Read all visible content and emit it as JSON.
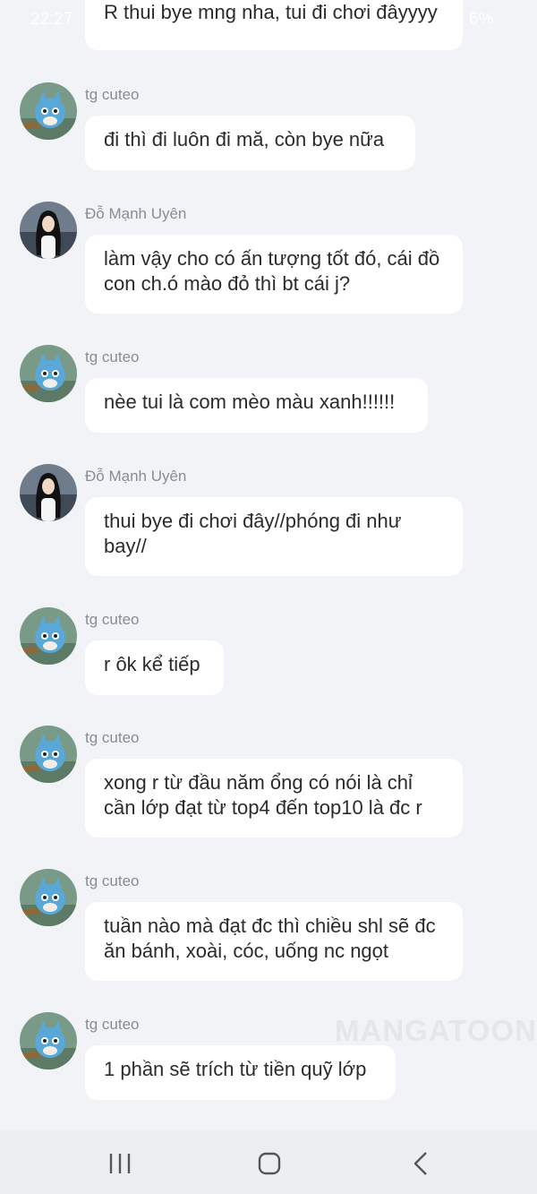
{
  "status": {
    "time": "22:27",
    "battery": "6%"
  },
  "messages": [
    {
      "sender": "",
      "avatar": "",
      "text": "R thui bye mng nha, tui đi chơi đâyyyy"
    },
    {
      "sender": "tg cuteo",
      "avatar": "blue-cat-avatar",
      "text": "đi thì đi luôn đi mă, còn bye nữa"
    },
    {
      "sender": "Đỗ Mạnh Uyên",
      "avatar": "girl-avatar",
      "text": "làm vậy cho có ấn tượng tốt đó, cái đồ con ch.ó mào đỏ thì bt cái j?"
    },
    {
      "sender": "tg cuteo",
      "avatar": "blue-cat-avatar",
      "text": "nèe tui là com mèo màu xanh!!!!!!"
    },
    {
      "sender": "Đỗ Mạnh Uyên",
      "avatar": "girl-avatar",
      "text": "thui bye đi chơi đây//phóng đi như bay//"
    },
    {
      "sender": "tg cuteo",
      "avatar": "blue-cat-avatar",
      "text": "r ôk kể tiếp"
    },
    {
      "sender": "tg cuteo",
      "avatar": "blue-cat-avatar",
      "text": "xong r từ đầu năm ổng có nói là chỉ cần lớp đạt từ top4 đến top10 là đc r"
    },
    {
      "sender": "tg cuteo",
      "avatar": "blue-cat-avatar",
      "text": "tuần nào mà đạt đc thì chiều shl sẽ đc ăn bánh, xoài, cóc, uống nc ngọt"
    },
    {
      "sender": "tg cuteo",
      "avatar": "blue-cat-avatar",
      "text": "1 phần sẽ trích từ tiền quỹ lớp"
    }
  ],
  "watermark": "MANGATOON",
  "nav": {
    "recents_icon": "recents-icon",
    "home_icon": "home-icon",
    "back_icon": "back-icon"
  },
  "colors": {
    "background": "#f2f3f7",
    "bubble": "#ffffff",
    "sender": "#8a8c93",
    "text": "#2b2b2b"
  }
}
